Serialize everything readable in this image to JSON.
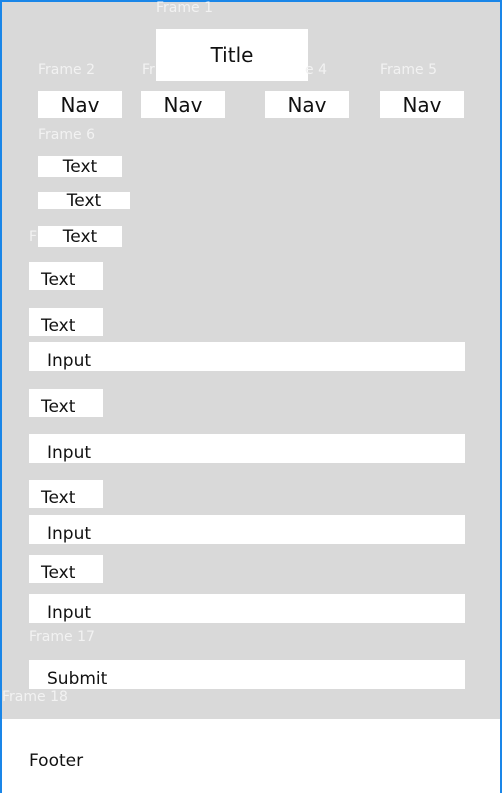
{
  "frames": {
    "f1": "Frame 1",
    "f2": "Frame 2",
    "f3": "Fr",
    "f4": "e 4",
    "f5": "Frame 5",
    "f6": "Frame 6",
    "f7": "F",
    "f17": "Frame 17",
    "f18": "Frame 18"
  },
  "header": {
    "title": "Title"
  },
  "nav": [
    "Nav",
    "Nav",
    "Nav",
    "Nav"
  ],
  "section1": [
    "Text",
    "Text",
    "Text"
  ],
  "form": {
    "label1": "Text",
    "label2": "Text",
    "input1": "Input",
    "label3": "Text",
    "input2": "Input",
    "label4": "Text",
    "input3": "Input",
    "label5": "Text",
    "input4": "Input",
    "submit": "Submit"
  },
  "footer": {
    "text": "Footer"
  }
}
